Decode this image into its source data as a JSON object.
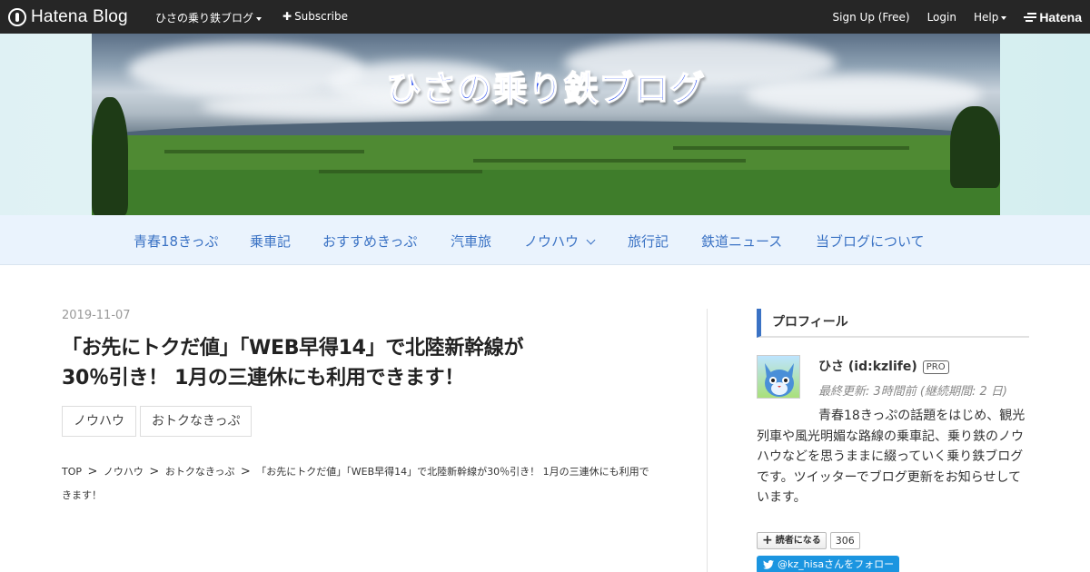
{
  "topbar": {
    "brand": "Hatena Blog",
    "blog_menu": "ひさの乗り鉄ブログ",
    "subscribe": "Subscribe",
    "signup": "Sign Up (Free)",
    "login": "Login",
    "help": "Help",
    "hatena": "Hatena"
  },
  "header": {
    "title": "ひさの乗り鉄ブログ"
  },
  "nav": {
    "items": [
      {
        "label": "青春18きっぷ"
      },
      {
        "label": "乗車記"
      },
      {
        "label": "おすすめきっぷ"
      },
      {
        "label": "汽車旅"
      },
      {
        "label": "ノウハウ"
      },
      {
        "label": "旅行記"
      },
      {
        "label": "鉄道ニュース"
      },
      {
        "label": "当ブログについて"
      }
    ]
  },
  "article": {
    "date": "2019-11-07",
    "title_line1": "「お先にトクだ値」「WEB早得14」で北陸新幹線が",
    "title_line2": "30％引き！ 1月の三連休にも利用できます！",
    "categories": [
      "ノウハウ",
      "おトクなきっぷ"
    ],
    "breadcrumb": {
      "top": "TOP",
      "level1": "ノウハウ",
      "level2": "おトクなきっぷ",
      "current": "「お先にトクだ値」「WEB早得14」で北陸新幹線が30％引き！ 1月の三連休にも利用できます！",
      "separator": ">"
    }
  },
  "sidebar": {
    "heading": "プロフィール",
    "profile": {
      "name": "ひさ (id:kzlife)",
      "badge": "PRO",
      "updated": "最終更新: 3時間前 (継続期間: 2 日)",
      "description": "青春18きっぷの話題をはじめ、観光列車や風光明媚な路線の乗車記、乗り鉄のノウハウなどを思うままに綴っていく乗り鉄ブログです。ツイッターでブログ更新をお知らせしています。"
    },
    "reader_button": "読者になる",
    "reader_count": "306",
    "twitter_button": "@kz_hisaさんをフォロー"
  },
  "colors": {
    "topbar_bg": "#262626",
    "nav_bg": "#eaf3fd",
    "nav_link": "#3a72c4",
    "title_blue": "#2b4ff0",
    "twitter_blue": "#1b95e0"
  },
  "icons": {
    "brand": "hatena-blog-logo-icon",
    "subscribe": "plus-icon",
    "hatena": "hatena-logo-icon",
    "dropdown": "chevron-down-icon",
    "twitter": "twitter-bird-icon",
    "reader": "plus-icon"
  }
}
